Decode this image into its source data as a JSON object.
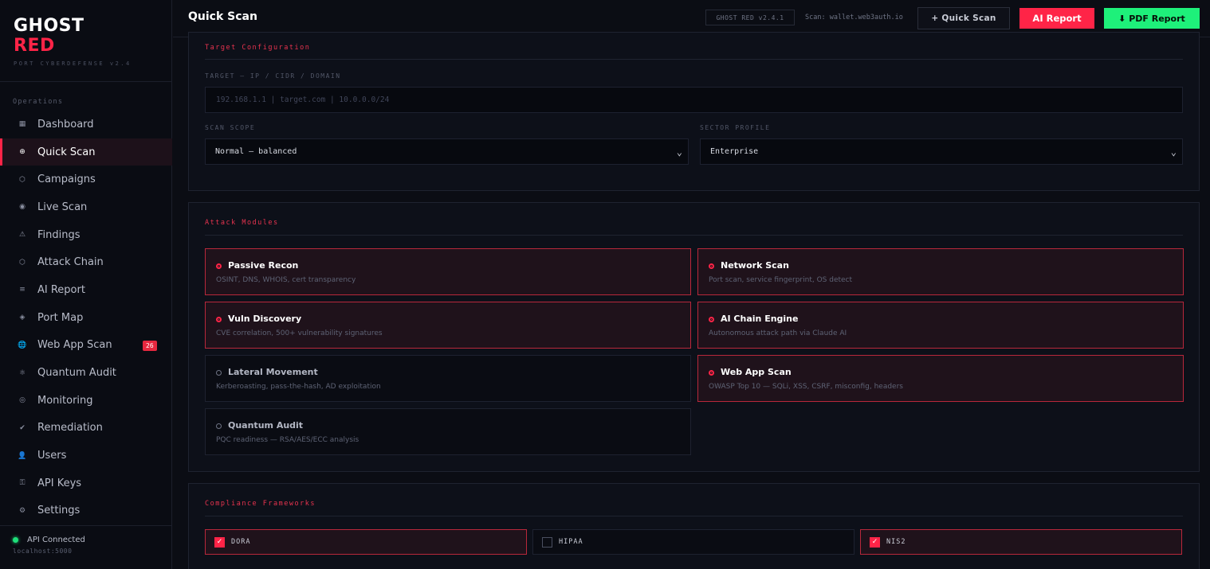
{
  "brand": {
    "line1": "GHOST",
    "line2": "RED",
    "subtitle": "PORT CYBERDEFENSE v2.4"
  },
  "sidebar": {
    "section": "Operations",
    "items": [
      {
        "label": "Dashboard",
        "icon": "grid-icon",
        "glyph": "▦"
      },
      {
        "label": "Quick Scan",
        "icon": "crosshair-icon",
        "glyph": "⊕",
        "active": true
      },
      {
        "label": "Campaigns",
        "icon": "hexagon-icon",
        "glyph": "⬡"
      },
      {
        "label": "Live Scan",
        "icon": "radio-icon",
        "glyph": "◉"
      },
      {
        "label": "Findings",
        "icon": "warning-icon",
        "glyph": "⚠"
      },
      {
        "label": "Attack Chain",
        "icon": "chain-icon",
        "glyph": "⬡"
      },
      {
        "label": "AI Report",
        "icon": "list-icon",
        "glyph": "≡"
      },
      {
        "label": "Port Map",
        "icon": "diamond-icon",
        "glyph": "◈"
      },
      {
        "label": "Web App Scan",
        "icon": "globe-icon",
        "glyph": "🌐",
        "badge": "26"
      },
      {
        "label": "Quantum Audit",
        "icon": "atom-icon",
        "glyph": "⚛"
      },
      {
        "label": "Monitoring",
        "icon": "target-icon",
        "glyph": "◎"
      },
      {
        "label": "Remediation",
        "icon": "check-icon",
        "glyph": "✔"
      },
      {
        "label": "Users",
        "icon": "user-icon",
        "glyph": "👤"
      },
      {
        "label": "API Keys",
        "icon": "key-icon",
        "glyph": "⚿"
      },
      {
        "label": "Settings",
        "icon": "gear-icon",
        "glyph": "⚙"
      }
    ],
    "footer": {
      "status": "API Connected",
      "host": "localhost:5000"
    }
  },
  "topbar": {
    "title": "Quick Scan",
    "version": "GHOST RED v2.4.1",
    "scan_target": "Scan: wallet.web3auth.io",
    "quick_scan_label": "+ Quick Scan",
    "ai_report_label": "AI Report",
    "pdf_report_label": "⬇ PDF Report"
  },
  "target_config": {
    "heading": "Target Configuration",
    "target_label": "TARGET — IP / CIDR / DOMAIN",
    "target_placeholder": "192.168.1.1  |  target.com  |  10.0.0.0/24",
    "scope_label": "SCAN SCOPE",
    "scope_value": "Normal — balanced",
    "sector_label": "SECTOR PROFILE",
    "sector_value": "Enterprise"
  },
  "attack_modules": {
    "heading": "Attack Modules",
    "modules": [
      {
        "title": "Passive Recon",
        "desc": "OSINT, DNS, WHOIS, cert transparency",
        "selected": true
      },
      {
        "title": "Network Scan",
        "desc": "Port scan, service fingerprint, OS detect",
        "selected": true
      },
      {
        "title": "Vuln Discovery",
        "desc": "CVE correlation, 500+ vulnerability signatures",
        "selected": true
      },
      {
        "title": "AI Chain Engine",
        "desc": "Autonomous attack path via Claude AI",
        "selected": true
      },
      {
        "title": "Lateral Movement",
        "desc": "Kerberoasting, pass-the-hash, AD exploitation",
        "selected": false
      },
      {
        "title": "Web App Scan",
        "desc": "OWASP Top 10 — SQLi, XSS, CSRF, misconfig, headers",
        "selected": true
      },
      {
        "title": "Quantum Audit",
        "desc": "PQC readiness — RSA/AES/ECC analysis",
        "selected": false
      }
    ]
  },
  "compliance": {
    "heading": "Compliance Frameworks",
    "frameworks": [
      {
        "label": "DORA",
        "checked": true
      },
      {
        "label": "HIPAA",
        "checked": false
      },
      {
        "label": "NIS2",
        "checked": true
      }
    ]
  },
  "colors": {
    "accent": "#ff2447",
    "success": "#1ef07a",
    "background": "#0b0d14"
  }
}
